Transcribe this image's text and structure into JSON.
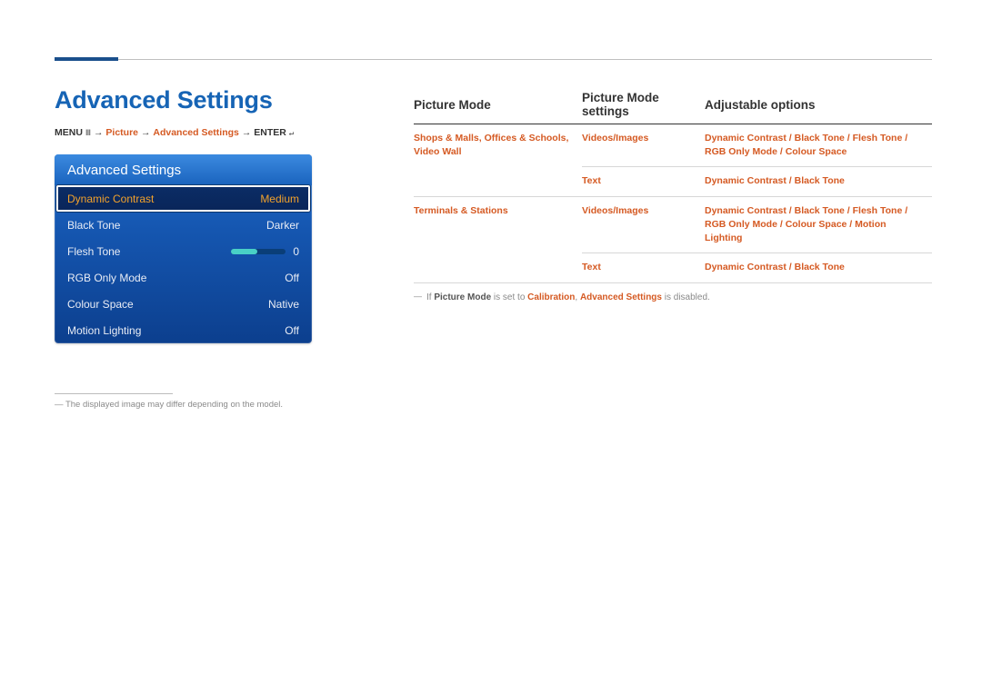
{
  "title": "Advanced Settings",
  "breadcrumb": {
    "menu": "MENU",
    "menu_icon": "Ⅲ",
    "arrow": "→",
    "picture": "Picture",
    "advanced": "Advanced Settings",
    "enter": "ENTER",
    "enter_icon": "↵"
  },
  "osd": {
    "title": "Advanced Settings",
    "rows": [
      {
        "label": "Dynamic Contrast",
        "value": "Medium",
        "selected": true
      },
      {
        "label": "Black Tone",
        "value": "Darker"
      },
      {
        "label": "Flesh Tone",
        "value": "0",
        "slider": true
      },
      {
        "label": "RGB Only Mode",
        "value": "Off"
      },
      {
        "label": "Colour Space",
        "value": "Native"
      },
      {
        "label": "Motion Lighting",
        "value": "Off"
      }
    ]
  },
  "footnote": "The displayed image may differ depending on the model.",
  "table": {
    "headers": [
      "Picture Mode",
      "Picture Mode settings",
      "Adjustable options"
    ],
    "rows": [
      {
        "mode": "Shops & Malls, Offices & Schools, Video Wall",
        "settings": "Videos/Images",
        "options": [
          "Dynamic Contrast",
          "Black Tone",
          "Flesh Tone",
          "RGB Only Mode",
          "Colour Space"
        ],
        "mode_rowspan": 2
      },
      {
        "settings": "Text",
        "options": [
          "Dynamic Contrast",
          "Black Tone"
        ]
      },
      {
        "mode": "Terminals & Stations",
        "settings": "Videos/Images",
        "options": [
          "Dynamic Contrast",
          "Black Tone",
          "Flesh Tone",
          "RGB Only Mode",
          "Colour Space",
          "Motion Lighting"
        ],
        "mode_rowspan": 2
      },
      {
        "settings": "Text",
        "options": [
          "Dynamic Contrast",
          "Black Tone"
        ]
      }
    ]
  },
  "note": {
    "prefix": "If ",
    "b1": "Picture Mode",
    "mid1": " is set to ",
    "a1": "Calibration",
    "mid2": ", ",
    "a2": "Advanced Settings",
    "suffix": " is disabled."
  }
}
